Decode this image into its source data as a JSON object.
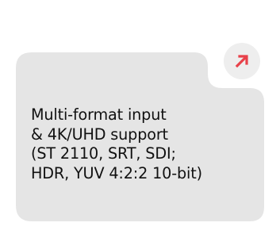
{
  "feature_card": {
    "text": "Multi-format input\n& 4K/UHD support\n(ST 2110, SRT, SDI;\nHDR, YUV 4:2:2 10-bit)",
    "action_icon": "arrow-up-right-icon",
    "colors": {
      "card_background": "#e5e5e5",
      "button_background": "#eeeeee",
      "accent": "#e8414a",
      "text": "#111111"
    }
  }
}
